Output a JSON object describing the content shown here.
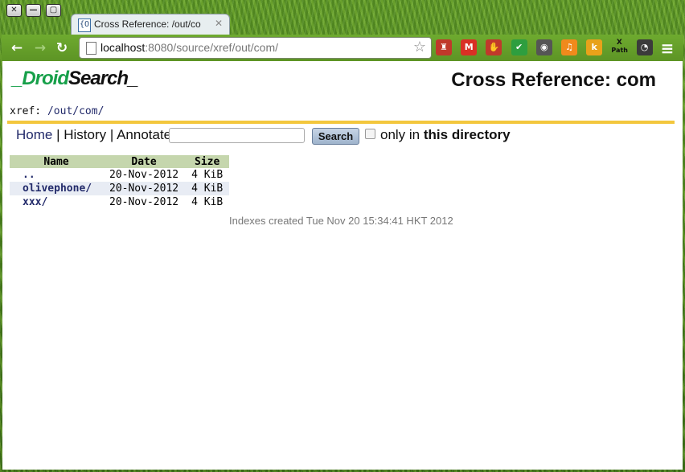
{
  "window": {
    "close_glyph": "✕",
    "minimize_glyph": "—",
    "maximize_glyph": "▢"
  },
  "tab": {
    "favicon_text": "{O",
    "title": "Cross Reference: /out/co",
    "close_glyph": "✕"
  },
  "toolbar": {
    "back_glyph": "←",
    "forward_glyph": "→",
    "reload_glyph": "↻",
    "url_host": "localhost",
    "url_rest": ":8080/source/xref/out/com/",
    "star_glyph": "☆",
    "menu_glyph": "≡",
    "extensions": [
      {
        "name": "red-hat-icon",
        "glyph": "♜",
        "color": "#c0392b"
      },
      {
        "name": "gmail-icon",
        "glyph": "M",
        "color": "#d93025"
      },
      {
        "name": "adblock-icon",
        "glyph": "✋",
        "color": "#c0392b"
      },
      {
        "name": "checkmark-icon",
        "glyph": "✔",
        "color": "#2e9e3f"
      },
      {
        "name": "evernote-icon",
        "glyph": "◉",
        "color": "#555555"
      },
      {
        "name": "music-icon",
        "glyph": "♫",
        "color": "#f08a1c"
      },
      {
        "name": "k-icon",
        "glyph": "k",
        "color": "#e8a21a"
      },
      {
        "name": "xpath-icon",
        "glyph": "X",
        "color": "#222222"
      },
      {
        "name": "owl-icon",
        "glyph": "◔",
        "color": "#3b3b3b"
      }
    ],
    "xpath_label": "Path"
  },
  "page": {
    "logo_green": "_Droid",
    "logo_black": "Search_",
    "title": "Cross Reference: com",
    "xref_prefix": "xref: ",
    "xref_path": "/out/com/",
    "nav": {
      "home": "Home",
      "sep1": " | ",
      "history": "History",
      "sep2": " | ",
      "annotate": "Annotate"
    },
    "search_button": "Search",
    "only_in": "only in ",
    "this_directory": "this directory",
    "table": {
      "headers": [
        "Name",
        "Date",
        "Size"
      ],
      "rows": [
        {
          "name": "..",
          "date": "20-Nov-2012",
          "size": "4 KiB"
        },
        {
          "name": "olivephone/",
          "date": "20-Nov-2012",
          "size": "4 KiB"
        },
        {
          "name": "xxx/",
          "date": "20-Nov-2012",
          "size": "4 KiB"
        }
      ]
    },
    "footer": "Indexes created Tue Nov 20 15:34:41 HKT 2012"
  },
  "colors": {
    "accent_rule": "#f3c73d",
    "link": "#222a6a",
    "logo_green": "#17a04a",
    "table_header": "#c5d6ad"
  }
}
